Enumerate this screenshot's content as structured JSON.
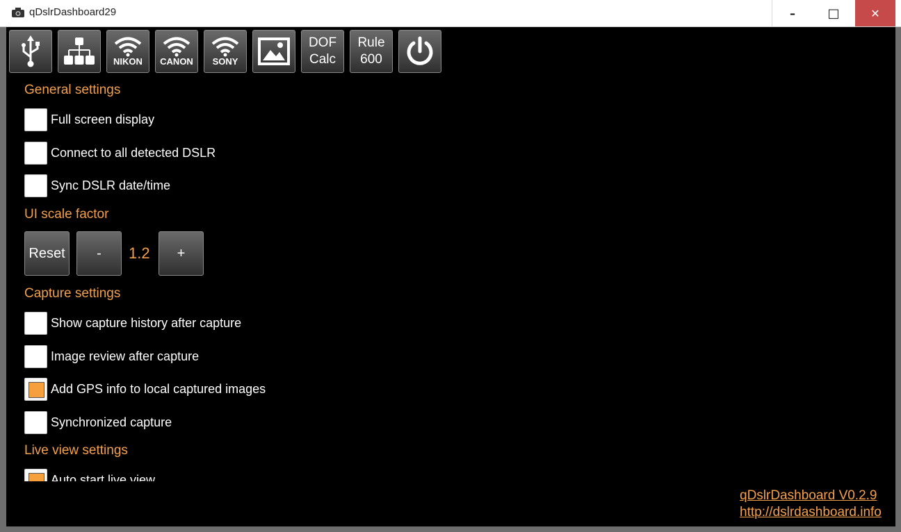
{
  "window": {
    "title": "qDslrDashboard29",
    "minimize_glyph": "–",
    "maximize_glyph": "□",
    "close_glyph": "✕"
  },
  "toolbar": {
    "buttons": [
      {
        "name": "usb-icon",
        "label": ""
      },
      {
        "name": "network-icon",
        "label": ""
      },
      {
        "name": "wifi-nikon",
        "label": "NIKON"
      },
      {
        "name": "wifi-canon",
        "label": "CANON"
      },
      {
        "name": "wifi-sony",
        "label": "SONY"
      },
      {
        "name": "image-icon",
        "label": ""
      },
      {
        "name": "dof-calc",
        "label_line1": "DOF",
        "label_line2": "Calc"
      },
      {
        "name": "rule-600",
        "label_line1": "Rule",
        "label_line2": "600"
      },
      {
        "name": "power-icon",
        "label": ""
      }
    ]
  },
  "general": {
    "title": "General settings",
    "items": [
      {
        "label": "Full screen display",
        "checked": false
      },
      {
        "label": "Connect to all detected DSLR",
        "checked": false
      },
      {
        "label": "Sync DSLR date/time",
        "checked": false
      }
    ]
  },
  "ui_scale": {
    "title": "UI scale factor",
    "reset_label": "Reset",
    "minus_label": "-",
    "value": "1.2",
    "plus_label": "+"
  },
  "capture": {
    "title": "Capture settings",
    "items": [
      {
        "label": "Show capture history after capture",
        "checked": false
      },
      {
        "label": "Image review after capture",
        "checked": false
      },
      {
        "label": "Add GPS info to local captured images",
        "checked": true
      },
      {
        "label": "Synchronized capture",
        "checked": false
      }
    ]
  },
  "liveview": {
    "title": "Live view settings",
    "items": [
      {
        "label": "Auto start live view",
        "checked": true
      }
    ]
  },
  "footer": {
    "version": "qDslrDashboard V0.2.9",
    "url": "http://dslrdashboard.info"
  },
  "colors": {
    "accent": "#f5a04a",
    "background": "#000000",
    "close_button": "#c74a4a"
  }
}
